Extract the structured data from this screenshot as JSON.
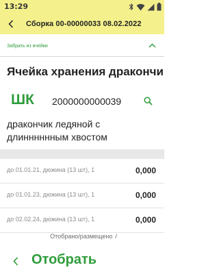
{
  "status_bar": {
    "time": "13:29",
    "icons": [
      "bluetooth-icon",
      "wifi-icon",
      "signal-icon",
      "battery-icon"
    ]
  },
  "app_bar": {
    "title": "Сборка 00-00000033 08.02.2022"
  },
  "section": {
    "label": "Забрать из ячейки"
  },
  "cell": {
    "title": "Ячейка хранения дракончиков"
  },
  "barcode": {
    "label": "ШК",
    "value": "2000000000039"
  },
  "item": {
    "name": "дракончик ледяной с длинннннным хвостом"
  },
  "rows": [
    {
      "desc": "до 01.01.21, дюжина (13 шт), 1",
      "qty": "0,000"
    },
    {
      "desc": "до 01.01.23, дюжина (13 шт), 1",
      "qty": "0,000"
    },
    {
      "desc": "до 02.02.24, дюжина (13 шт), 1",
      "qty": "0,000"
    }
  ],
  "summary": {
    "label": "Отобрано/размещено",
    "value": "/"
  },
  "action": {
    "label": "Отобрать"
  },
  "colors": {
    "accent_green": "#2e9c3a",
    "header_yellow": "#f4f18c"
  }
}
